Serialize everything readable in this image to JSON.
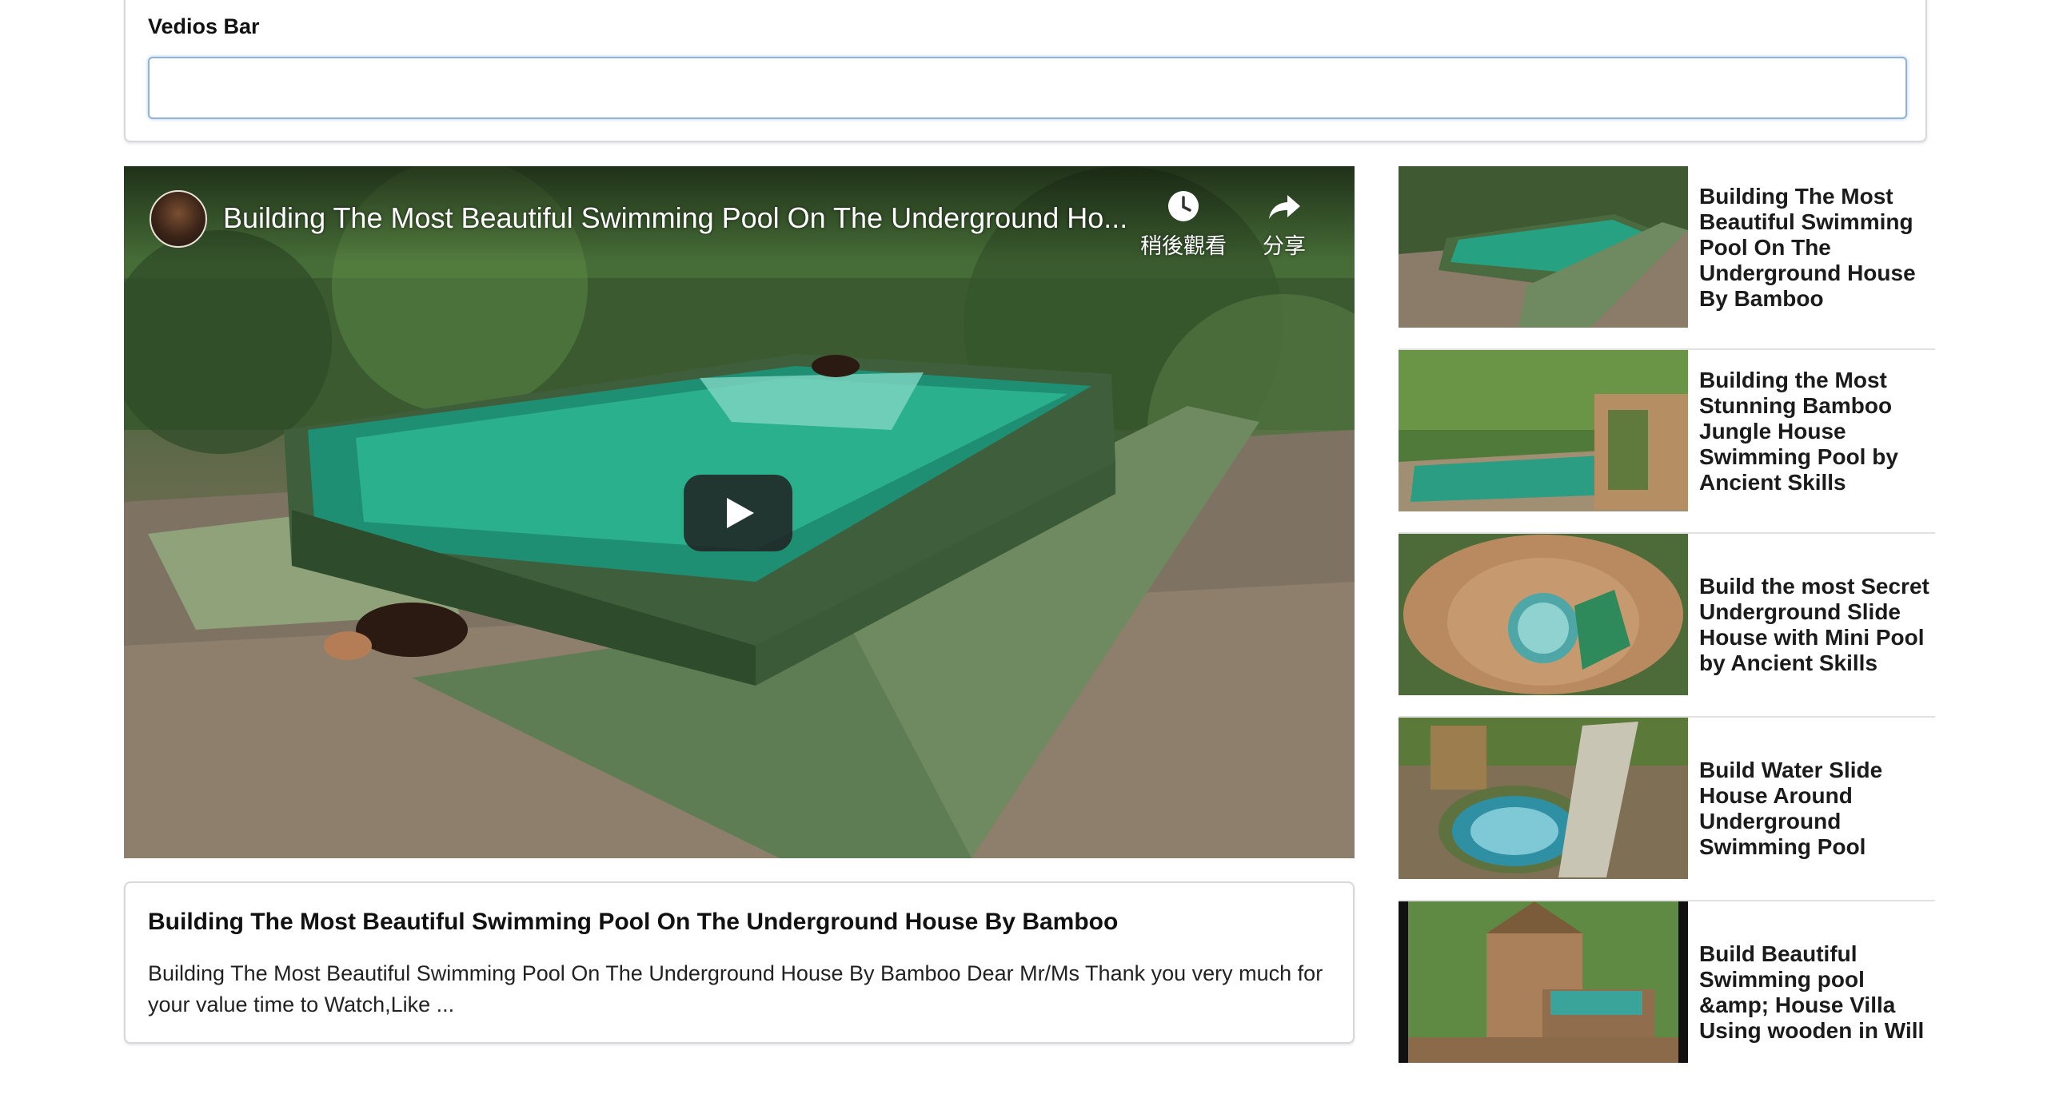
{
  "search": {
    "label": "Vedios Bar",
    "value": "",
    "placeholder": ""
  },
  "player": {
    "title": "Building The Most Beautiful Swimming Pool On The Underground Ho...",
    "watch_later_label": "稍後觀看",
    "share_label": "分享"
  },
  "description": {
    "title": "Building The Most Beautiful Swimming Pool On The Underground House By Bamboo",
    "text": "Building The Most Beautiful Swimming Pool On The Underground House By Bamboo Dear Mr/Ms Thank you very much for your value time to Watch,Like ..."
  },
  "sidebar": {
    "videos": [
      {
        "title": "Building The Most Beautiful Swimming Pool On The Underground House By Bamboo"
      },
      {
        "title": "Building the Most Stunning Bamboo Jungle House Swimming Pool by Ancient Skills"
      },
      {
        "title": "Build the most Secret Underground Slide House with Mini Pool by Ancient Skills"
      },
      {
        "title": "Build Water Slide House Around Underground Swimming Pool"
      },
      {
        "title": "Build Beautiful Swimming pool &amp; House Villa Using wooden in Will"
      }
    ]
  },
  "icons": {
    "watch_later": "clock-icon",
    "share": "share-arrow-icon",
    "play": "play-icon"
  },
  "colors": {
    "input_focus_border": "#8fb3d9",
    "card_border": "#d8d8dc",
    "play_button_bg": "#212121"
  }
}
